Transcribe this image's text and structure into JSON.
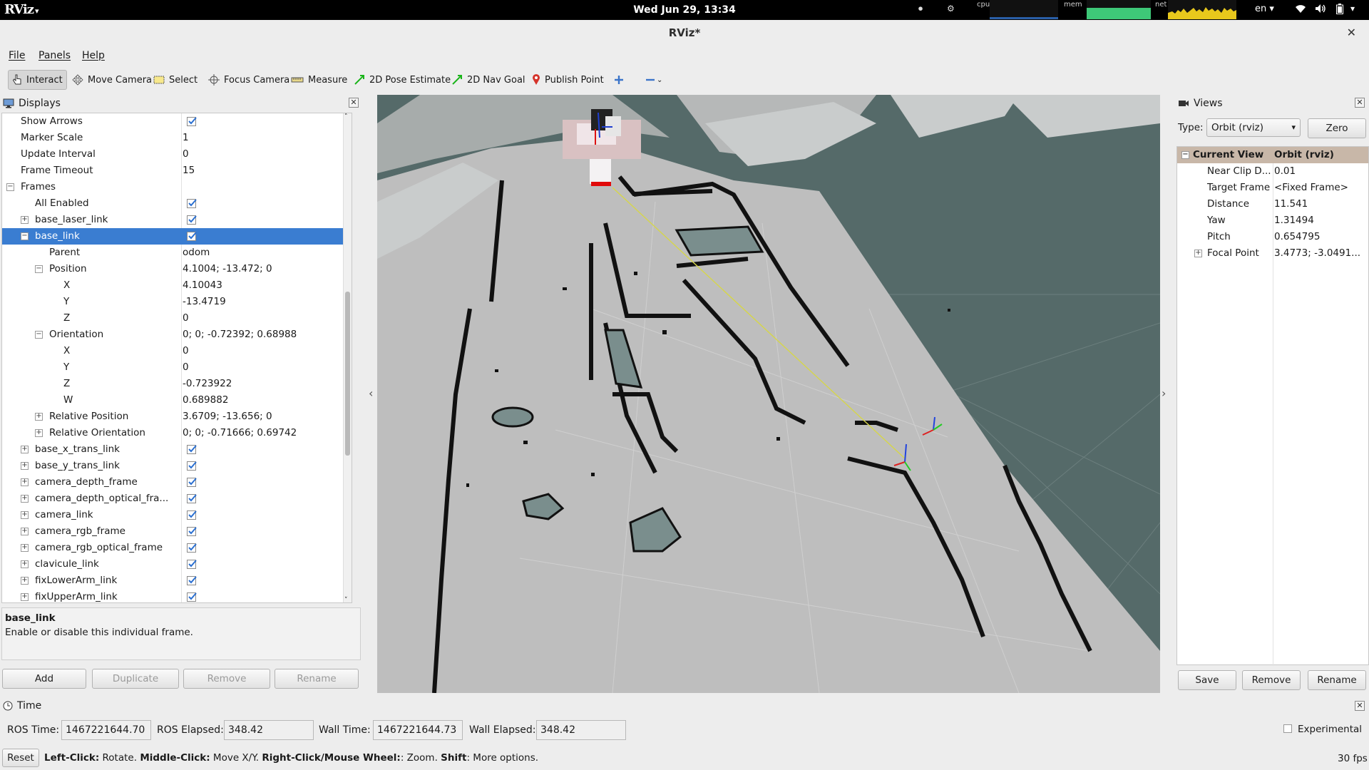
{
  "topbar": {
    "app_logo": "RViz",
    "app_menu": "RViz",
    "clock": "Wed Jun 29, 13:34",
    "graph_labels": {
      "cpu": "cpu",
      "mem": "mem",
      "net": "net"
    },
    "language": "en",
    "icons": [
      "stop-icon",
      "network-wired-icon",
      "wifi-icon",
      "volume-icon",
      "battery-icon"
    ]
  },
  "window": {
    "title": "RViz*"
  },
  "menu": {
    "file": "File",
    "panels": "Panels",
    "help": "Help"
  },
  "toolbar": {
    "interact": "Interact",
    "move_camera": "Move Camera",
    "select": "Select",
    "focus_camera": "Focus Camera",
    "measure": "Measure",
    "pose_estimate": "2D Pose Estimate",
    "nav_goal": "2D Nav Goal",
    "publish_point": "Publish Point"
  },
  "displays": {
    "title": "Displays",
    "rows": [
      {
        "name": "Show Arrows",
        "value": "",
        "check": true
      },
      {
        "name": "Marker Scale",
        "value": "1"
      },
      {
        "name": "Update Interval",
        "value": "0"
      },
      {
        "name": "Frame Timeout",
        "value": "15"
      },
      {
        "name": "Frames",
        "value": ""
      },
      {
        "name": "All Enabled",
        "value": "",
        "check": true
      },
      {
        "name": "base_laser_link",
        "value": "",
        "check": true
      },
      {
        "name": "base_link",
        "value": "",
        "check": true
      },
      {
        "name": "Parent",
        "value": "odom"
      },
      {
        "name": "Position",
        "value": "4.1004; -13.472; 0"
      },
      {
        "name": "X",
        "value": "4.10043"
      },
      {
        "name": "Y",
        "value": "-13.4719"
      },
      {
        "name": "Z",
        "value": "0"
      },
      {
        "name": "Orientation",
        "value": "0; 0; -0.72392; 0.68988"
      },
      {
        "name": "X",
        "value": "0"
      },
      {
        "name": "Y",
        "value": "0"
      },
      {
        "name": "Z",
        "value": "-0.723922"
      },
      {
        "name": "W",
        "value": "0.689882"
      },
      {
        "name": "Relative Position",
        "value": "3.6709; -13.656; 0"
      },
      {
        "name": "Relative Orientation",
        "value": "0; 0; -0.71666; 0.69742"
      },
      {
        "name": "base_x_trans_link",
        "value": "",
        "check": true
      },
      {
        "name": "base_y_trans_link",
        "value": "",
        "check": true
      },
      {
        "name": "camera_depth_frame",
        "value": "",
        "check": true
      },
      {
        "name": "camera_depth_optical_fra...",
        "value": "",
        "check": true
      },
      {
        "name": "camera_link",
        "value": "",
        "check": true
      },
      {
        "name": "camera_rgb_frame",
        "value": "",
        "check": true
      },
      {
        "name": "camera_rgb_optical_frame",
        "value": "",
        "check": true
      },
      {
        "name": "clavicule_link",
        "value": "",
        "check": true
      },
      {
        "name": "fixLowerArm_link",
        "value": "",
        "check": true
      },
      {
        "name": "fixUpperArm_link",
        "value": "",
        "check": true
      }
    ],
    "description_title": "base_link",
    "description_text": "Enable or disable this individual frame.",
    "buttons": {
      "add": "Add",
      "duplicate": "Duplicate",
      "remove": "Remove",
      "rename": "Rename"
    }
  },
  "views": {
    "title": "Views",
    "type_label": "Type:",
    "type_value": "Orbit (rviz)",
    "zero": "Zero",
    "header": {
      "name": "Current View",
      "value": "Orbit (rviz)"
    },
    "rows": [
      {
        "name": "Near Clip D...",
        "value": "0.01"
      },
      {
        "name": "Target Frame",
        "value": "<Fixed Frame>"
      },
      {
        "name": "Distance",
        "value": "11.541"
      },
      {
        "name": "Yaw",
        "value": "1.31494"
      },
      {
        "name": "Pitch",
        "value": "0.654795"
      },
      {
        "name": "Focal Point",
        "value": "3.4773; -3.0491..."
      }
    ],
    "buttons": {
      "save": "Save",
      "remove": "Remove",
      "rename": "Rename"
    }
  },
  "time": {
    "title": "Time",
    "ros_time_label": "ROS Time:",
    "ros_time": "1467221644.70",
    "ros_elapsed_label": "ROS Elapsed:",
    "ros_elapsed": "348.42",
    "wall_time_label": "Wall Time:",
    "wall_time": "1467221644.73",
    "wall_elapsed_label": "Wall Elapsed:",
    "wall_elapsed": "348.42",
    "experimental": "Experimental",
    "reset": "Reset",
    "status": {
      "left_click": "Left-Click:",
      "left_click_text": " Rotate. ",
      "middle_click": "Middle-Click:",
      "middle_click_text": " Move X/Y. ",
      "right_click": "Right-Click/Mouse Wheel:",
      "right_click_text": ": Zoom. ",
      "shift": "Shift",
      "shift_text": ": More options."
    },
    "fps": "30 fps"
  }
}
